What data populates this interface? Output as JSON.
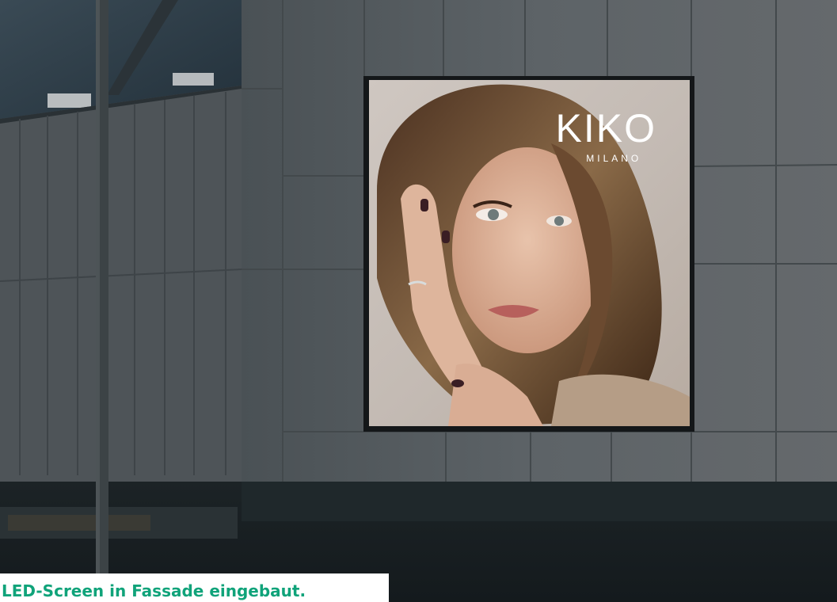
{
  "billboard": {
    "brand_name": "KIKO",
    "brand_subtitle": "MILANO"
  },
  "caption": {
    "text": "LED-Screen in Fassade eingebaut.",
    "color": "#10a37a"
  },
  "colors": {
    "facade": "#585f63",
    "sky": "#2f3e47",
    "ground": "#1a2124"
  }
}
